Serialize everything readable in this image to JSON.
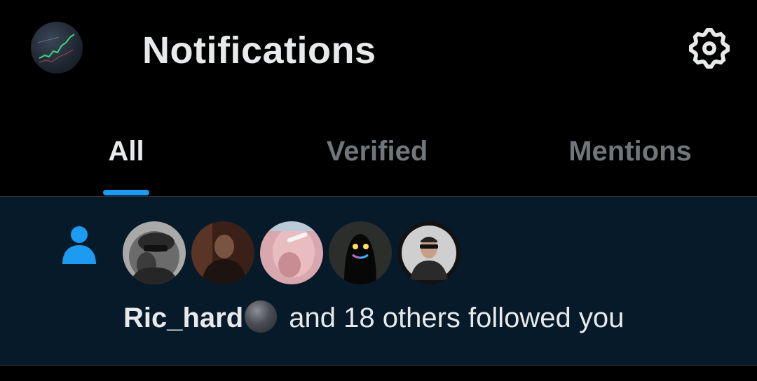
{
  "header": {
    "title": "Notifications",
    "account_avatar_icon": "account-avatar-chart",
    "settings_icon": "gear-icon"
  },
  "tabs": [
    {
      "label": "All",
      "active": true
    },
    {
      "label": "Verified",
      "active": false
    },
    {
      "label": "Mentions",
      "active": false
    }
  ],
  "notification": {
    "type_icon": "person-icon",
    "follower_avatars": [
      "avatar-1",
      "avatar-2",
      "avatar-3",
      "avatar-4",
      "avatar-5"
    ],
    "name": "Ric_hard",
    "name_emoji": "⚫",
    "message": " and 18 others followed you"
  },
  "colors": {
    "background": "#000000",
    "accent": "#1d9bf0",
    "text_primary": "#e7e9ea",
    "text_secondary": "#71767b",
    "unread_background": "#061a2a"
  }
}
